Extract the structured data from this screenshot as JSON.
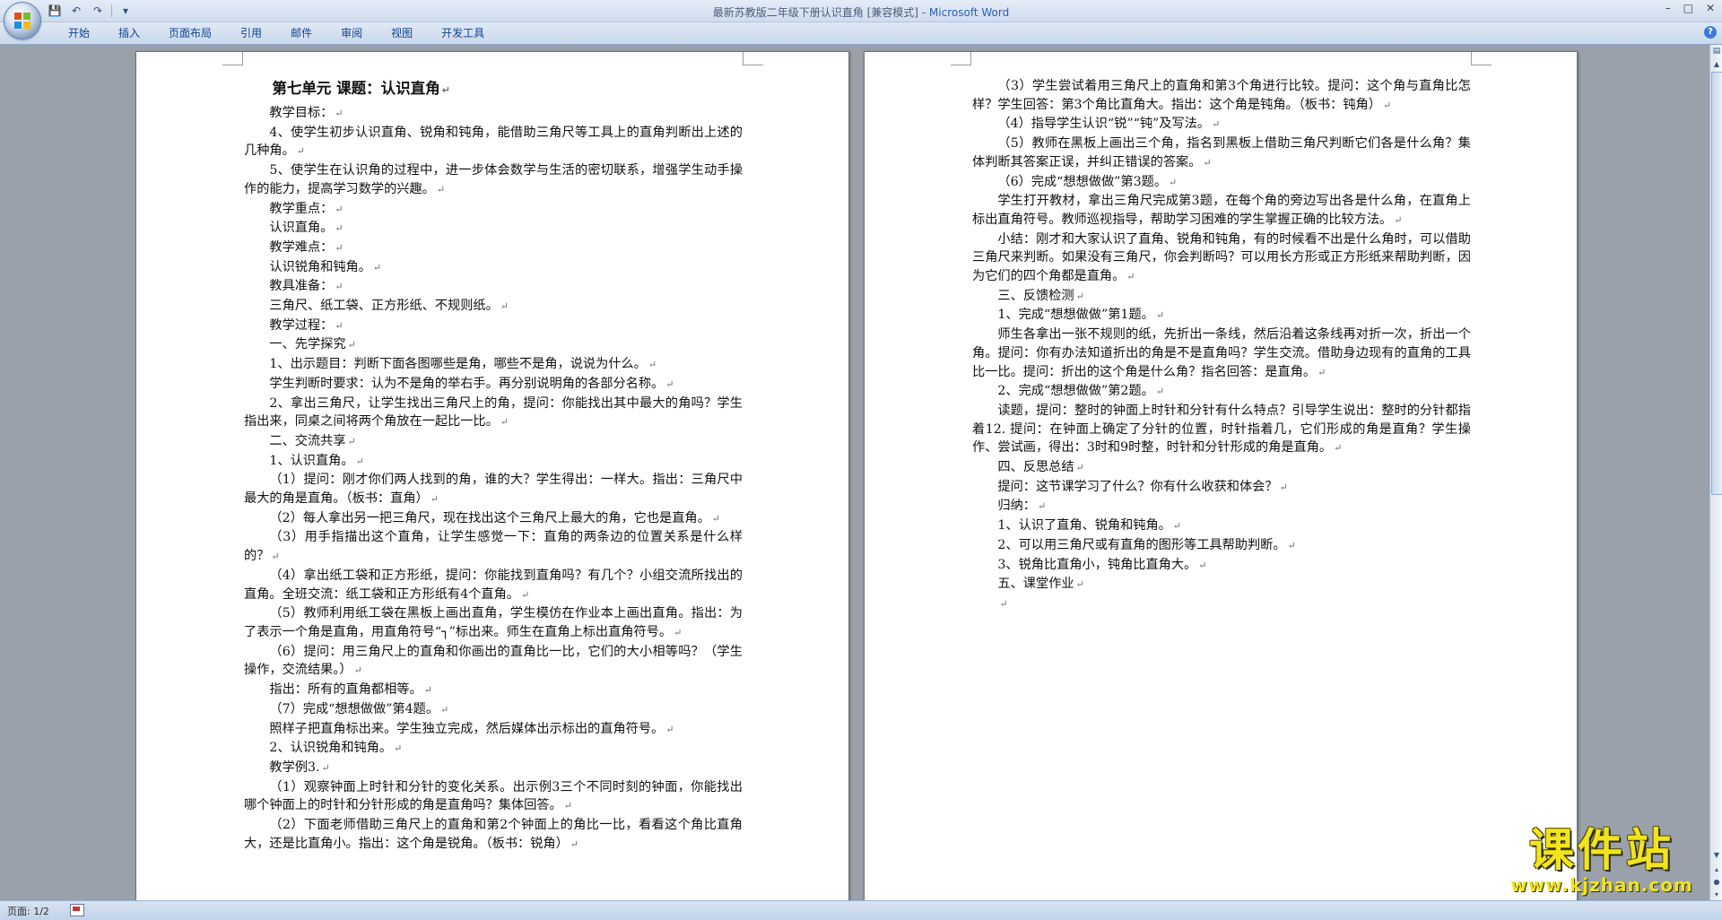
{
  "window": {
    "title": "最新苏教版二年级下册认识直角 [兼容模式] - ",
    "app_name": "Microsoft Word",
    "controls": [
      "–",
      "□",
      "✕"
    ]
  },
  "quick_access": {
    "save": "💾",
    "undo": "↶",
    "redo": "↷",
    "more": "▾"
  },
  "ribbon": {
    "tabs": [
      "开始",
      "插入",
      "页面布局",
      "引用",
      "邮件",
      "审阅",
      "视图",
      "开发工具"
    ],
    "help": "?"
  },
  "document": {
    "paragraph_mark": "↵",
    "left_page": [
      {
        "t": "第七单元 课题：认识直角",
        "heading": true
      },
      {
        "t": "教学目标："
      },
      {
        "t": "4、使学生初步认识直角、锐角和钝角，能借助三角尺等工具上的直角判断出上述的几种角。"
      },
      {
        "t": "5、使学生在认识角的过程中，进一步体会数学与生活的密切联系，增强学生动手操作的能力，提高学习数学的兴趣。"
      },
      {
        "t": "教学重点："
      },
      {
        "t": "认识直角。"
      },
      {
        "t": "教学难点："
      },
      {
        "t": "认识锐角和钝角。"
      },
      {
        "t": "教具准备："
      },
      {
        "t": "三角尺、纸工袋、正方形纸、不规则纸。"
      },
      {
        "t": "教学过程："
      },
      {
        "t": "一、先学探究"
      },
      {
        "t": "1、出示题目：判断下面各图哪些是角，哪些不是角，说说为什么。"
      },
      {
        "t": "学生判断时要求：认为不是角的举右手。再分别说明角的各部分名称。"
      },
      {
        "t": "2、拿出三角尺，让学生找出三角尺上的角，提问：你能找出其中最大的角吗？学生指出来，同桌之间将两个角放在一起比一比。"
      },
      {
        "t": "二、交流共享"
      },
      {
        "t": "1、认识直角。"
      },
      {
        "t": "（1）提问：刚才你们两人找到的角，谁的大？学生得出：一样大。指出：三角尺中最大的角是直角。（板书：直角）"
      },
      {
        "t": "（2）每人拿出另一把三角尺，现在找出这个三角尺上最大的角，它也是直角。"
      },
      {
        "t": "（3）用手指描出这个直角，让学生感觉一下：直角的两条边的位置关系是什么样的？"
      },
      {
        "t": "（4）拿出纸工袋和正方形纸，提问：你能找到直角吗？有几个？小组交流所找出的直角。全班交流：纸工袋和正方形纸有4个直角。"
      },
      {
        "t": "（5）教师利用纸工袋在黑板上画出直角，学生模仿在作业本上画出直角。指出：为了表示一个角是直角，用直角符号“┐”标出来。师生在直角上标出直角符号。"
      },
      {
        "t": "（6）提问：用三角尺上的直角和你画出的直角比一比，它们的大小相等吗？（学生操作，交流结果。）"
      },
      {
        "t": "指出：所有的直角都相等。"
      },
      {
        "t": "（7）完成“想想做做”第4题。"
      },
      {
        "t": "照样子把直角标出来。学生独立完成，然后媒体出示标出的直角符号。"
      },
      {
        "t": "2、认识锐角和钝角。"
      },
      {
        "t": "教学例3."
      },
      {
        "t": "（1）观察钟面上时针和分针的变化关系。出示例3三个不同时刻的钟面，你能找出哪个钟面上的时针和分针形成的角是直角吗？集体回答。"
      },
      {
        "t": "（2）下面老师借助三角尺上的直角和第2个钟面上的角比一比，看看这个角比直角大，还是比直角小。指出：这个角是锐角。（板书：锐角）"
      }
    ],
    "right_page": [
      {
        "t": "（3）学生尝试着用三角尺上的直角和第3个角进行比较。提问：这个角与直角比怎样？学生回答：第3个角比直角大。指出：这个角是钝角。（板书：钝角）"
      },
      {
        "t": "（4）指导学生认识“锐”“钝”及写法。"
      },
      {
        "t": "（5）教师在黑板上画出三个角，指名到黑板上借助三角尺判断它们各是什么角？集体判断其答案正误，并纠正错误的答案。"
      },
      {
        "t": "（6）完成“想想做做”第3题。"
      },
      {
        "t": "学生打开教材，拿出三角尺完成第3题，在每个角的旁边写出各是什么角，在直角上标出直角符号。教师巡视指导，帮助学习困难的学生掌握正确的比较方法。"
      },
      {
        "t": "小结：刚才和大家认识了直角、锐角和钝角，有的时候看不出是什么角时，可以借助三角尺来判断。如果没有三角尺，你会判断吗？可以用长方形或正方形纸来帮助判断，因为它们的四个角都是直角。"
      },
      {
        "t": "三、反馈检测"
      },
      {
        "t": "1、完成“想想做做”第1题。"
      },
      {
        "t": "师生各拿出一张不规则的纸，先折出一条线，然后沿着这条线再对折一次，折出一个角。提问：你有办法知道折出的角是不是直角吗？学生交流。借助身边现有的直角的工具比一比。提问：折出的这个角是什么角？指名回答：是直角。"
      },
      {
        "t": "2、完成“想想做做”第2题。"
      },
      {
        "t": "读题，提问：整时的钟面上时针和分针有什么特点？引导学生说出：整时的分针都指着12. 提问：在钟面上确定了分针的位置，时针指着几，它们形成的角是直角？学生操作、尝试画，得出：3时和9时整，时针和分针形成的角是直角。"
      },
      {
        "t": "四、反思总结"
      },
      {
        "t": "提问：这节课学习了什么？你有什么收获和体会？"
      },
      {
        "t": "归纳："
      },
      {
        "t": "1、认识了直角、锐角和钝角。"
      },
      {
        "t": "2、可以用三角尺或有直角的图形等工具帮助判断。"
      },
      {
        "t": "3、锐角比直角小，钝角比直角大。"
      },
      {
        "t": "五、课堂作业"
      },
      {
        "t": ""
      }
    ]
  },
  "statusbar": {
    "page": "页面: 1/2"
  },
  "watermark": {
    "main": "课件站",
    "url": "www.kjzhan.com"
  }
}
